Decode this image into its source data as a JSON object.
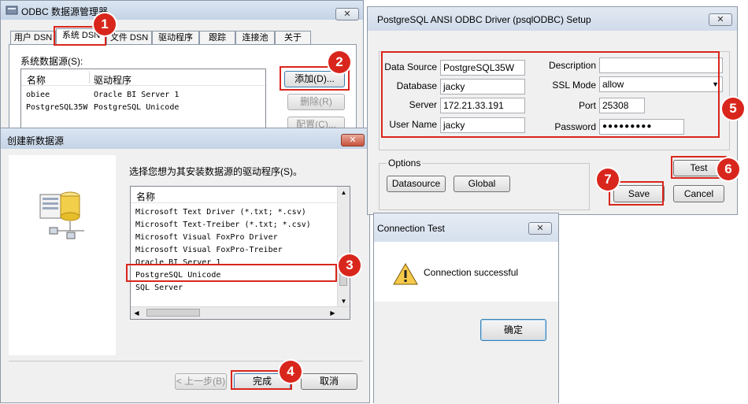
{
  "odbc": {
    "title": "ODBC 数据源管理器",
    "close": "✕",
    "tabs": [
      "用户 DSN",
      "系统 DSN",
      "文件 DSN",
      "驱动程序",
      "跟踪",
      "连接池",
      "关于"
    ],
    "section_label": "系统数据源(S):",
    "col_name": "名称",
    "col_driver": "驱动程序",
    "rows": [
      {
        "name": "obiee",
        "driver": "Oracle BI Server 1"
      },
      {
        "name": "PostgreSQL35W",
        "driver": "PostgreSQL Unicode"
      }
    ],
    "add_label": "添加(D)...",
    "remove_label": "删除(R)",
    "config_label": "配置(C)..."
  },
  "create": {
    "title": "创建新数据源",
    "close": "✕",
    "prompt": "选择您想为其安装数据源的驱动程序(S)。",
    "col_name": "名称",
    "drivers": [
      "Microsoft Text Driver (*.txt; *.csv)",
      "Microsoft Text-Treiber (*.txt; *.csv)",
      "Microsoft Visual FoxPro Driver",
      "Microsoft Visual FoxPro-Treiber",
      "Oracle BI Server 1",
      "PostgreSQL Unicode",
      "SQL Server"
    ],
    "back_label": "< 上一步(B)",
    "finish_label": "完成",
    "cancel_label": "取消"
  },
  "setup": {
    "title": "PostgreSQL ANSI ODBC Driver (psqlODBC) Setup",
    "close": "✕",
    "data_source_label": "Data Source",
    "data_source_value": "PostgreSQL35W",
    "database_label": "Database",
    "database_value": "jacky",
    "server_label": "Server",
    "server_value": "172.21.33.191",
    "user_label": "User Name",
    "user_value": "jacky",
    "description_label": "Description",
    "description_value": "",
    "ssl_label": "SSL Mode",
    "ssl_value": "allow",
    "port_label": "Port",
    "port_value": "25308",
    "password_label": "Password",
    "password_value": "●●●●●●●●●",
    "options_label": "Options",
    "datasource_btn": "Datasource",
    "global_btn": "Global",
    "test_btn": "Test",
    "save_btn": "Save",
    "cancel_btn": "Cancel"
  },
  "conn": {
    "title": "Connection Test",
    "close": "✕",
    "message": "Connection successful",
    "ok_label": "确定"
  },
  "badges": [
    "1",
    "2",
    "3",
    "4",
    "5",
    "6",
    "7"
  ],
  "colors": {
    "highlight": "#d9261c",
    "badge": "#d9261c"
  }
}
